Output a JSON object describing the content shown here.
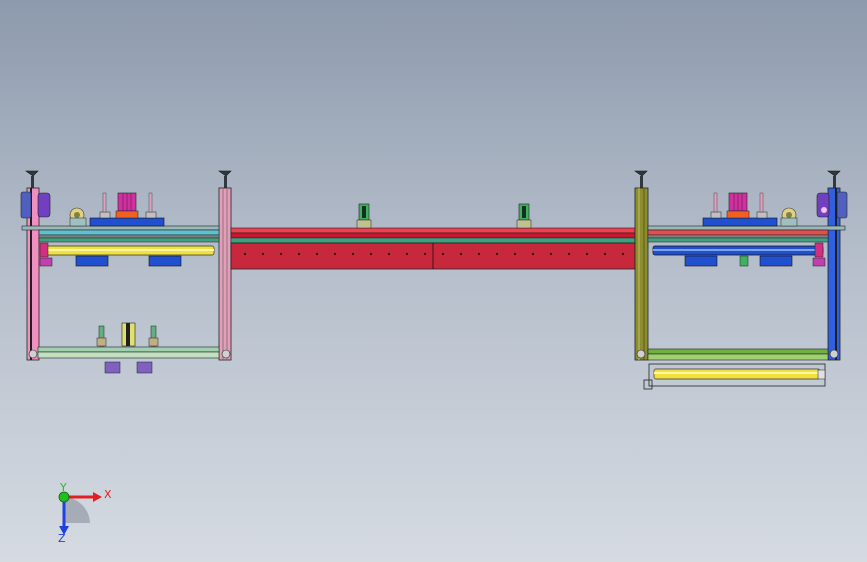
{
  "view": {
    "background_top": "#8d9aad",
    "background_bottom": "#d6dbe2"
  },
  "triad": {
    "x_label": "X",
    "y_label": "Y",
    "z_label": "Z",
    "x_color": "#e02020",
    "y_color": "#20c020",
    "z_color": "#2040e0"
  },
  "parts": {
    "main_beam_color": "#c8283c",
    "left_frame_color": "#e0a0b8",
    "right_frame_color": "#8c8c30",
    "rail_yellow": "#f0e040",
    "block_blue": "#2050d0",
    "motor_purple": "#7040c0",
    "cylinder_magenta": "#d030a0",
    "sensor_green": "#40b060",
    "outer_post_left": "#f090c0",
    "outer_post_right": "#3060e0"
  }
}
